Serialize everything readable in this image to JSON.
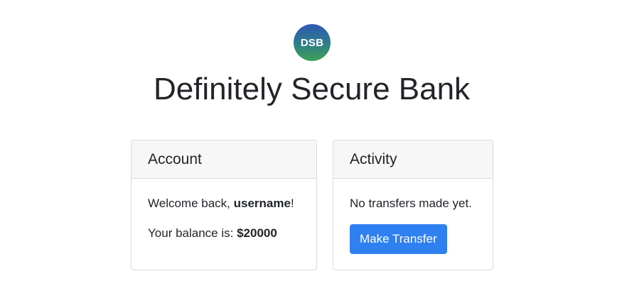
{
  "logo": {
    "text": "DSB"
  },
  "title": "Definitely Secure Bank",
  "account": {
    "header": "Account",
    "welcome_prefix": "Welcome back, ",
    "username": "username",
    "welcome_suffix": "!",
    "balance_label": "Your balance is: ",
    "balance_value": "$20000"
  },
  "activity": {
    "header": "Activity",
    "status": "No transfers made yet.",
    "button_label": "Make Transfer"
  },
  "colors": {
    "button": "#2f80f1",
    "logo_top": "#2c58b5",
    "logo_bottom": "#3ea155",
    "card_header_bg": "#f7f7f7"
  }
}
